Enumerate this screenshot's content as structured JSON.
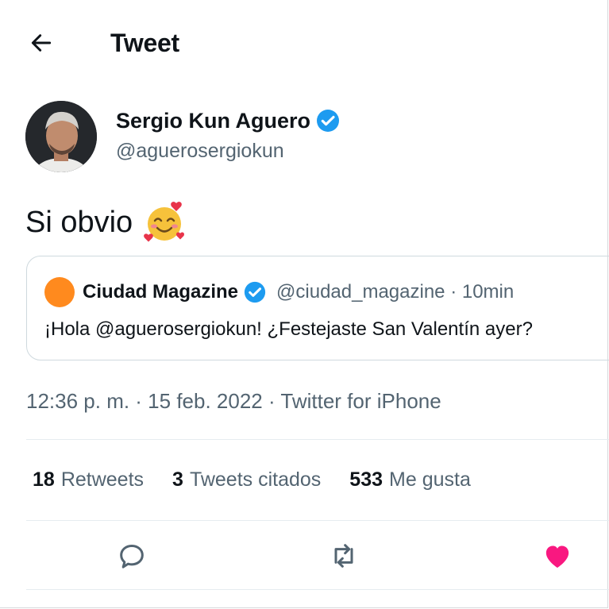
{
  "header": {
    "title": "Tweet",
    "back_icon": "back-arrow-icon"
  },
  "author": {
    "name": "Sergio Kun Aguero",
    "handle": "@aguerosergiokun",
    "verified": true
  },
  "tweet": {
    "text": "Si obvio",
    "emoji": "smiling-face-with-hearts"
  },
  "quote": {
    "name": "Ciudad Magazine",
    "handle_time": "@ciudad_magazine · 10min",
    "text": "¡Hola @aguerosergiokun! ¿Festejaste San Valentín ayer?",
    "verified": true
  },
  "meta": {
    "timestamp": "12:36 p. m. · 15 feb. 2022 · Twitter for iPhone"
  },
  "stats": {
    "retweets_count": "18",
    "retweets_label": "Retweets",
    "quotes_count": "3",
    "quotes_label": "Tweets citados",
    "likes_count": "533",
    "likes_label": "Me gusta"
  },
  "colors": {
    "accent": "#1d9bf0",
    "like": "#f91880",
    "muted": "#536471",
    "text": "#0f1419"
  }
}
